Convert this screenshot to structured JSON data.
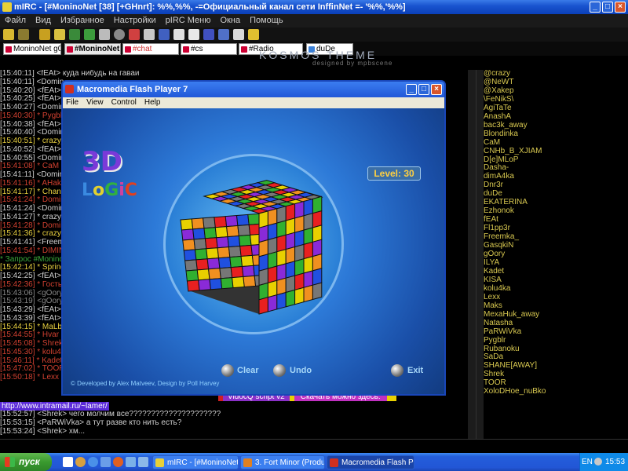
{
  "mirc": {
    "title": "mIRC - [#MoninoNet [38] [+GHnrt]: %%,%%, -=Официальный канал сети InffinNet =- '%%,'%%]",
    "menu": [
      "Файл",
      "Вид",
      "Избранное",
      "Настройки",
      "pIRC Меню",
      "Окна",
      "Помощь"
    ],
    "tabs": [
      {
        "label": "MoninoNet g0...",
        "active": false
      },
      {
        "label": "#MoninoNet",
        "active": true
      },
      {
        "label": "#chat",
        "active": false
      },
      {
        "label": "#cs",
        "active": false
      },
      {
        "label": "#Radio",
        "active": false
      },
      {
        "label": "duDe",
        "active": false
      }
    ],
    "theme_title": "KOSMOS THEME",
    "theme_sub": "designed by mpbscene"
  },
  "chat": {
    "lines": [
      {
        "text": "[15:40:11] <fEAt> куда нибудь на гаваи",
        "color": "#cfcfcf"
      },
      {
        "text": "[15:40:11] <Domin",
        "color": "#cfcfcf"
      },
      {
        "text": "[15:40:20] <fEAt>",
        "color": "#cfcfcf"
      },
      {
        "text": "[15:40:25] <fEAt>",
        "color": "#cfcfcf"
      },
      {
        "text": "[15:40:27] <Domin",
        "color": "#cfcfcf"
      },
      {
        "text": "[15:40:30] * Pygbl",
        "color": "#d04030"
      },
      {
        "text": "[15:40:38] <fEAt>",
        "color": "#cfcfcf"
      },
      {
        "text": "[15:40:40] <Domin",
        "color": "#cfcfcf"
      },
      {
        "text": "[15:40:51] * crazy_",
        "color": "#e8d040"
      },
      {
        "text": "[15:40:52] <fEAt>",
        "color": "#cfcfcf"
      },
      {
        "text": "[15:40:55] <Domin",
        "color": "#cfcfcf"
      },
      {
        "text": "[15:41:08] * CaM (",
        "color": "#d04030"
      },
      {
        "text": "[15:41:11] <Domin",
        "color": "#cfcfcf"
      },
      {
        "text": "[15:41:16] * AHako",
        "color": "#d04030"
      },
      {
        "text": "[15:41:17] * ChanS",
        "color": "#e8d040"
      },
      {
        "text": "[15:41:24] * Domin",
        "color": "#d04030"
      },
      {
        "text": "[15:41:24] <Domin",
        "color": "#cfcfcf"
      },
      {
        "text": "[15:41:27] * crazy",
        "color": "#cfcfcf"
      },
      {
        "text": "[15:41:28] * Domin",
        "color": "#d04030"
      },
      {
        "text": "[15:41:36] * crazy",
        "color": "#e8d040"
      },
      {
        "text": "[15:41:41] <Freem",
        "color": "#cfcfcf"
      },
      {
        "text": "[15:41:54] * DIMIN",
        "color": "#d04030"
      },
      {
        "text": "* Запрос #MoninoN",
        "color": "#3aa83a"
      },
      {
        "text": "[15:42:14] * SpringG",
        "color": "#e8d040"
      },
      {
        "text": "[15:42:25] <fEAt>",
        "color": "#cfcfcf"
      },
      {
        "text": "[15:42:36] * Гость",
        "color": "#d04030"
      },
      {
        "text": "[15:43:06] <gOory",
        "color": "#888888"
      },
      {
        "text": "[15:43:19] <gOory",
        "color": "#888888"
      },
      {
        "text": "[15:43:29] <fEAt>",
        "color": "#cfcfcf"
      },
      {
        "text": "[15:43:39] <fEAt>",
        "color": "#cfcfcf"
      },
      {
        "text": "[15:44:15] * MaLbl",
        "color": "#e8d040"
      },
      {
        "text": "[15:44:55] * Hvar",
        "color": "#d04030"
      },
      {
        "text": "[15:45:08] * Shrek",
        "color": "#d04030"
      },
      {
        "text": "[15:45:30] * kolu4",
        "color": "#d04030"
      },
      {
        "text": "[15:46:11] * Kadet",
        "color": "#d04030"
      },
      {
        "text": "[15:47:02] * TOOR",
        "color": "#d04030"
      },
      {
        "text": "[15:50:18] * Lexx",
        "color": "#d04030"
      }
    ],
    "banner_left": "VidocQ script v2",
    "banner_right": "Скачать можно здесь:",
    "url": "http://www.intramail.ru/~lamer/",
    "bottom_lines": [
      {
        "text": "[15:52:57] <Shrek> чего молчим все?????????????????????",
        "color": "#cfcfcf"
      },
      {
        "text": "[15:53:15] <PaRWiVka> а тут разве кто нить есть?",
        "color": "#cfcfcf"
      },
      {
        "text": "[15:53:24] <Shrek> хм...",
        "color": "#cfcfcf"
      }
    ]
  },
  "nicklist": [
    "@crazy",
    "@NeWT",
    "@Xakep",
    "\\FeNikS\\",
    "AgiTaTe",
    "AnashA",
    "bac3k_away",
    "Blondinka",
    "CaM",
    "CNHb_B_XJIAM",
    "D[e]MLoP",
    "Dasha-",
    "dimA4ka",
    "Dnr3r",
    "duDe",
    "EKATERINA",
    "Ezhonok",
    "fEAt",
    "Fl1pp3r",
    "Freemka_",
    "GasqkiN",
    "gOory",
    "ILYA",
    "Kadet",
    "KISA",
    "kolu4ka",
    "Lexx",
    "Maks",
    "MexaHuk_away",
    "Natasha",
    "PaRWiVka",
    "Pygblr",
    "Rubanoku",
    "SaDa",
    "SHANE[AWAY]",
    "Shrek",
    "TOOR",
    "XoloDHoe_nuBko"
  ],
  "flash": {
    "title": "Macromedia Flash Player 7",
    "menu": [
      "File",
      "View",
      "Control",
      "Help"
    ],
    "level": "Level: 30",
    "logo_3d": "3D",
    "logo_logic": "LoGiC",
    "clear_label": "Clear",
    "undo_label": "Undo",
    "exit_label": "Exit",
    "credits": "© Developed by Alex Matveev, Design by Poll Harvey"
  },
  "taskbar": {
    "start_label": "пуск",
    "tasks": [
      {
        "label": "mIRC - [#MoninoNet ...",
        "active": false
      },
      {
        "label": "3. Fort Minor (Produc...",
        "active": false
      },
      {
        "label": "Macromedia Flash Pla...",
        "active": true
      }
    ],
    "lang": "EN",
    "clock": "15:53"
  }
}
